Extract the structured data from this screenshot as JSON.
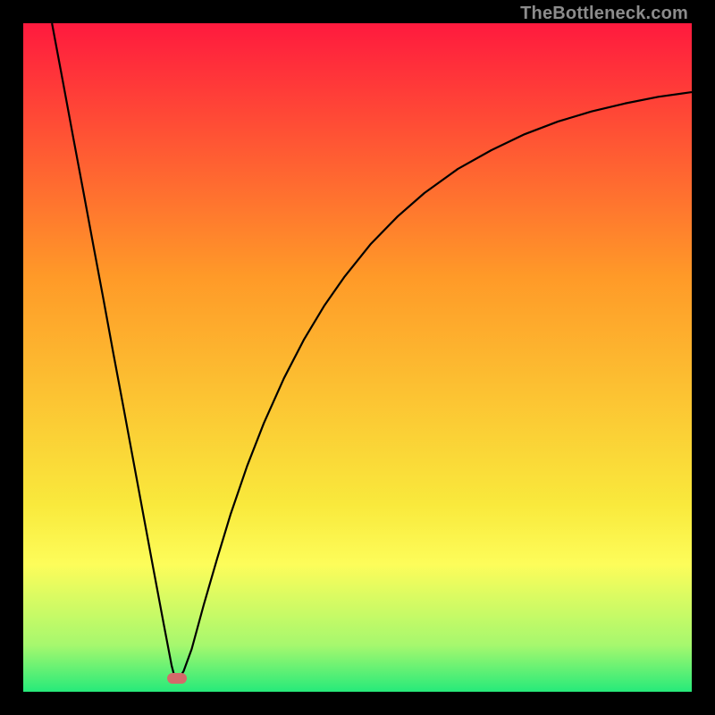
{
  "watermark": "TheBottleneck.com",
  "chart_data": {
    "type": "line",
    "title": "",
    "xlabel": "",
    "ylabel": "",
    "xlim": [
      0,
      100
    ],
    "ylim": [
      0,
      100
    ],
    "grid": false,
    "legend": false,
    "gradient_colors": {
      "top": "#ff1a3e",
      "mid_upper": "#ff9a28",
      "mid_lower": "#f9e93c",
      "band_upper": "#fdfd5a",
      "band_lower": "#a6f86e",
      "bottom": "#26ea7a"
    },
    "marker": {
      "x": 23,
      "y": 2,
      "color": "#d46a6a"
    },
    "series": [
      {
        "name": "curve",
        "points": [
          {
            "x": 4.3,
            "y": 100
          },
          {
            "x": 6.0,
            "y": 90.9
          },
          {
            "x": 7.5,
            "y": 82.8
          },
          {
            "x": 9.0,
            "y": 74.8
          },
          {
            "x": 10.5,
            "y": 66.7
          },
          {
            "x": 12.0,
            "y": 58.7
          },
          {
            "x": 13.5,
            "y": 50.5
          },
          {
            "x": 15.0,
            "y": 42.5
          },
          {
            "x": 16.5,
            "y": 34.4
          },
          {
            "x": 18.0,
            "y": 26.3
          },
          {
            "x": 19.5,
            "y": 18.2
          },
          {
            "x": 21.0,
            "y": 10.2
          },
          {
            "x": 22.2,
            "y": 3.9
          },
          {
            "x": 22.7,
            "y": 2.0
          },
          {
            "x": 23.3,
            "y": 2.0
          },
          {
            "x": 24.0,
            "y": 3.1
          },
          {
            "x": 25.2,
            "y": 6.4
          },
          {
            "x": 27.0,
            "y": 13.0
          },
          {
            "x": 29.0,
            "y": 19.9
          },
          {
            "x": 31.0,
            "y": 26.5
          },
          {
            "x": 33.5,
            "y": 33.8
          },
          {
            "x": 36.0,
            "y": 40.2
          },
          {
            "x": 39.0,
            "y": 46.9
          },
          {
            "x": 42.0,
            "y": 52.7
          },
          {
            "x": 45.0,
            "y": 57.7
          },
          {
            "x": 48.0,
            "y": 62.0
          },
          {
            "x": 52.0,
            "y": 67.0
          },
          {
            "x": 56.0,
            "y": 71.1
          },
          {
            "x": 60.0,
            "y": 74.6
          },
          {
            "x": 65.0,
            "y": 78.2
          },
          {
            "x": 70.0,
            "y": 81.0
          },
          {
            "x": 75.0,
            "y": 83.4
          },
          {
            "x": 80.0,
            "y": 85.3
          },
          {
            "x": 85.0,
            "y": 86.8
          },
          {
            "x": 90.0,
            "y": 88.0
          },
          {
            "x": 95.0,
            "y": 89.0
          },
          {
            "x": 100.0,
            "y": 89.7
          }
        ]
      }
    ]
  }
}
